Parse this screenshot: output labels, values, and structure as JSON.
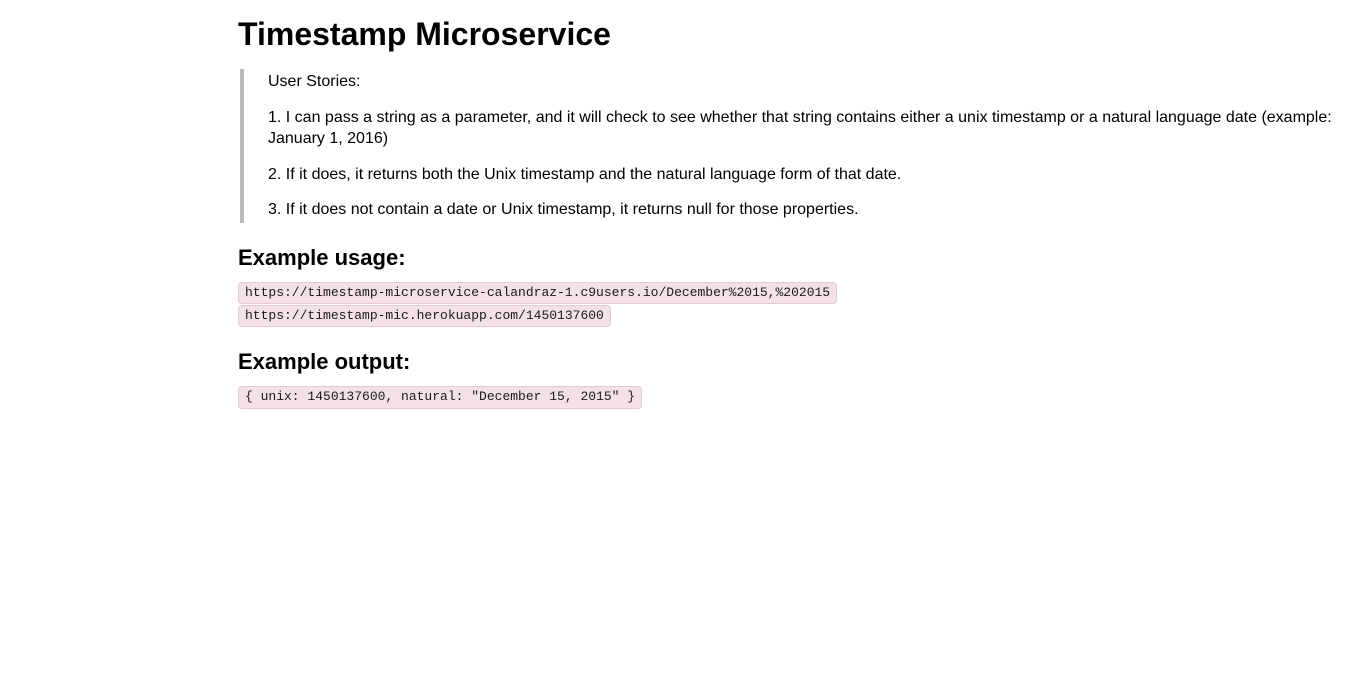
{
  "title": "Timestamp Microservice",
  "userStories": {
    "heading": "User Stories:",
    "items": [
      "1. I can pass a string as a parameter, and it will check to see whether that string contains either a unix timestamp or a natural language date (example: January 1, 2016)",
      "2. If it does, it returns both the Unix timestamp and the natural language form of that date.",
      "3. If it does not contain a date or Unix timestamp, it returns null for those properties."
    ]
  },
  "exampleUsage": {
    "heading": "Example usage:",
    "lines": [
      "https://timestamp-microservice-calandraz-1.c9users.io/December%2015,%202015",
      "https://timestamp-mic.herokuapp.com/1450137600"
    ]
  },
  "exampleOutput": {
    "heading": "Example output:",
    "lines": [
      "{ unix: 1450137600, natural: \"December 15, 2015\" }"
    ]
  }
}
